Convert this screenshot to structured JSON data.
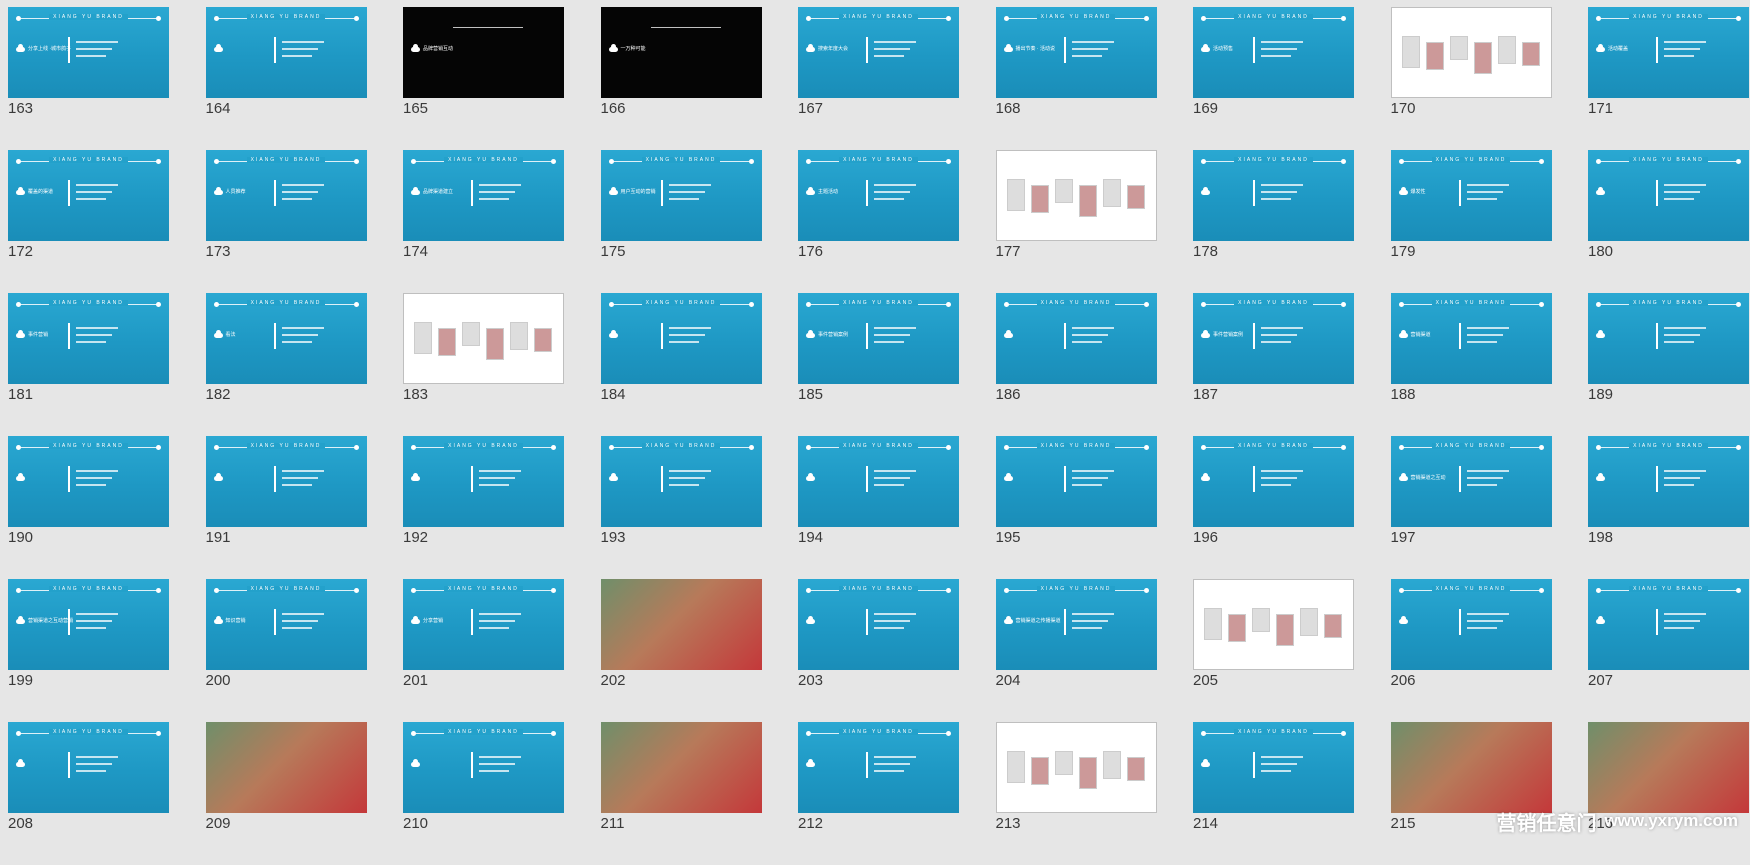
{
  "slides": [
    {
      "number": "163",
      "style": "blue",
      "title": "分享上线 ·城市鸽子"
    },
    {
      "number": "164",
      "style": "blue",
      "title": ""
    },
    {
      "number": "165",
      "style": "dark",
      "title": "品牌营销互动"
    },
    {
      "number": "166",
      "style": "dark",
      "title": "一万种可能"
    },
    {
      "number": "167",
      "style": "blue",
      "title": "搜索年度大会"
    },
    {
      "number": "168",
      "style": "blue",
      "title": "播出节奏 · 活动说"
    },
    {
      "number": "169",
      "style": "blue",
      "title": "活动预售"
    },
    {
      "number": "170",
      "style": "white",
      "title": ""
    },
    {
      "number": "171",
      "style": "blue",
      "title": "活动覆盖"
    },
    {
      "number": "172",
      "style": "blue",
      "title": "覆盖的渠道"
    },
    {
      "number": "173",
      "style": "blue",
      "title": "人员推荐"
    },
    {
      "number": "174",
      "style": "blue",
      "title": "品牌渠道建立"
    },
    {
      "number": "175",
      "style": "blue",
      "title": "用户互动的营销"
    },
    {
      "number": "176",
      "style": "blue",
      "title": "主题活动"
    },
    {
      "number": "177",
      "style": "white",
      "title": ""
    },
    {
      "number": "178",
      "style": "blue",
      "title": ""
    },
    {
      "number": "179",
      "style": "blue",
      "title": "爆发性"
    },
    {
      "number": "180",
      "style": "blue",
      "title": ""
    },
    {
      "number": "181",
      "style": "blue",
      "title": "事件营销"
    },
    {
      "number": "182",
      "style": "blue",
      "title": "看法"
    },
    {
      "number": "183",
      "style": "white",
      "title": ""
    },
    {
      "number": "184",
      "style": "blue",
      "title": ""
    },
    {
      "number": "185",
      "style": "blue",
      "title": "事件营销案例"
    },
    {
      "number": "186",
      "style": "blue",
      "title": ""
    },
    {
      "number": "187",
      "style": "blue",
      "title": "事件营销案例"
    },
    {
      "number": "188",
      "style": "blue",
      "title": "营销渠道"
    },
    {
      "number": "189",
      "style": "blue",
      "title": ""
    },
    {
      "number": "190",
      "style": "blue",
      "title": ""
    },
    {
      "number": "191",
      "style": "blue",
      "title": ""
    },
    {
      "number": "192",
      "style": "blue",
      "title": ""
    },
    {
      "number": "193",
      "style": "blue",
      "title": ""
    },
    {
      "number": "194",
      "style": "blue",
      "title": ""
    },
    {
      "number": "195",
      "style": "blue",
      "title": ""
    },
    {
      "number": "196",
      "style": "blue",
      "title": ""
    },
    {
      "number": "197",
      "style": "blue",
      "title": "营销渠道之互动"
    },
    {
      "number": "198",
      "style": "blue",
      "title": ""
    },
    {
      "number": "199",
      "style": "blue",
      "title": "营销渠道之互动营销"
    },
    {
      "number": "200",
      "style": "blue",
      "title": "知识营销"
    },
    {
      "number": "201",
      "style": "blue",
      "title": "分享营销"
    },
    {
      "number": "202",
      "style": "photo",
      "title": ""
    },
    {
      "number": "203",
      "style": "blue",
      "title": ""
    },
    {
      "number": "204",
      "style": "blue",
      "title": "营销渠道之传播渠道"
    },
    {
      "number": "205",
      "style": "white",
      "title": ""
    },
    {
      "number": "206",
      "style": "blue",
      "title": ""
    },
    {
      "number": "207",
      "style": "blue",
      "title": ""
    },
    {
      "number": "208",
      "style": "blue",
      "title": ""
    },
    {
      "number": "209",
      "style": "photo",
      "title": ""
    },
    {
      "number": "210",
      "style": "blue",
      "title": ""
    },
    {
      "number": "211",
      "style": "photo",
      "title": ""
    },
    {
      "number": "212",
      "style": "blue",
      "title": ""
    },
    {
      "number": "213",
      "style": "white",
      "title": ""
    },
    {
      "number": "214",
      "style": "blue",
      "title": ""
    },
    {
      "number": "215",
      "style": "photo",
      "title": ""
    },
    {
      "number": "216",
      "style": "photo",
      "title": ""
    }
  ],
  "brand_text": "XIANG  YU  BRAND",
  "watermark": {
    "text": "营销任意门",
    "url": "www.yxrym.com"
  }
}
